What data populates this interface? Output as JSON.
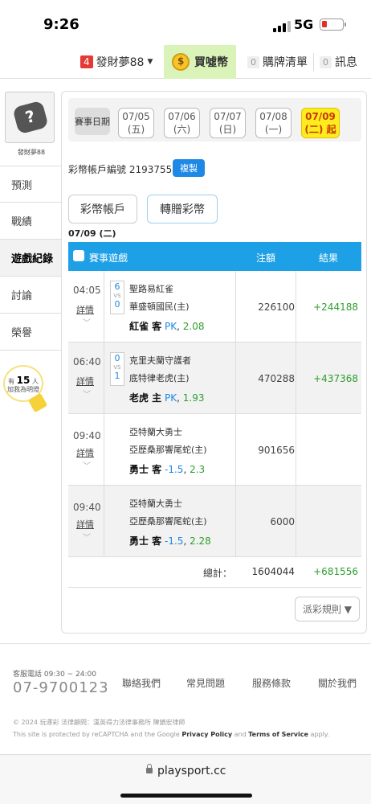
{
  "status": {
    "time": "9:26",
    "network": "5G"
  },
  "topnav": {
    "dream_count": "4",
    "dream_label": "發財夢88",
    "buy_coins": "買噓幣",
    "cart_count": "0",
    "cart_label": "購牌清單",
    "msg_count": "0",
    "msg_label": "訊息"
  },
  "sidebar": {
    "username": "發財夢88",
    "items": [
      {
        "label": "預測"
      },
      {
        "label": "戰績"
      },
      {
        "label": "遊戲紀錄"
      },
      {
        "label": "討論"
      },
      {
        "label": "榮譽"
      }
    ],
    "bulb_prefix": "有",
    "bulb_count": "15",
    "bulb_suffix": "人",
    "bulb_line2": "加我為明燈"
  },
  "datebar": {
    "label": "賽事日期",
    "dates": [
      {
        "date": "07/05",
        "day": "(五)"
      },
      {
        "date": "07/06",
        "day": "(六)"
      },
      {
        "date": "07/07",
        "day": "(日)"
      },
      {
        "date": "07/08",
        "day": "(一)"
      },
      {
        "date": "07/09",
        "day": "(二) 起"
      }
    ]
  },
  "account": {
    "label": "彩幣帳戶編號",
    "number": "21937556",
    "copy": "複製"
  },
  "tabs": {
    "t1": "彩幣帳戶",
    "t2": "轉贈彩幣"
  },
  "selected_date": "07/09 (二)",
  "table": {
    "headers": {
      "game": "賽事遊戲",
      "amount": "注額",
      "result": "結果"
    },
    "detail_label": "詳情",
    "vs": "VS",
    "rows": [
      {
        "time": "04:05",
        "score_a": "6",
        "score_b": "0",
        "team_a": "聖路易紅雀",
        "team_b": "華盛頓國民(主)",
        "pick_who": "紅雀 客",
        "pick_type": "PK",
        "pick_odds": "2.08",
        "amount": "226100",
        "result": "+244188"
      },
      {
        "time": "06:40",
        "score_a": "0",
        "score_b": "1",
        "team_a": "克里夫蘭守護者",
        "team_b": "底特律老虎(主)",
        "pick_who": "老虎 主",
        "pick_type": "PK",
        "pick_odds": "1.93",
        "amount": "470288",
        "result": "+437368"
      },
      {
        "time": "09:40",
        "score_a": "",
        "score_b": "",
        "team_a": "亞特蘭大勇士",
        "team_b": "亞歷桑那響尾蛇(主)",
        "pick_who": "勇士 客",
        "pick_type": "-1.5",
        "pick_odds": "2.3",
        "amount": "901656",
        "result": ""
      },
      {
        "time": "09:40",
        "score_a": "",
        "score_b": "",
        "team_a": "亞特蘭大勇士",
        "team_b": "亞歷桑那響尾蛇(主)",
        "pick_who": "勇士 客",
        "pick_type": "-1.5",
        "pick_odds": "2.28",
        "amount": "6000",
        "result": ""
      }
    ],
    "total_label": "總計：",
    "total_amount": "1604044",
    "total_result": "+681556"
  },
  "rules_label": "派彩規則 ▼",
  "footer": {
    "service_label": "客服電話 09:30 ~ 24:00",
    "phone": "07-9700123",
    "links": [
      "聯絡我們",
      "常見問題",
      "服務條款",
      "關於我們"
    ],
    "copyright": "© 2024 玩運彩 法律顧問：漢英得力法律事務所 陳鎮宏律師",
    "captcha_pre": "This site is protected by reCAPTCHA and the Google",
    "privacy": "Privacy Policy",
    "and": "and",
    "terms": "Terms of Service",
    "apply": "apply."
  },
  "url": "playsport.cc"
}
